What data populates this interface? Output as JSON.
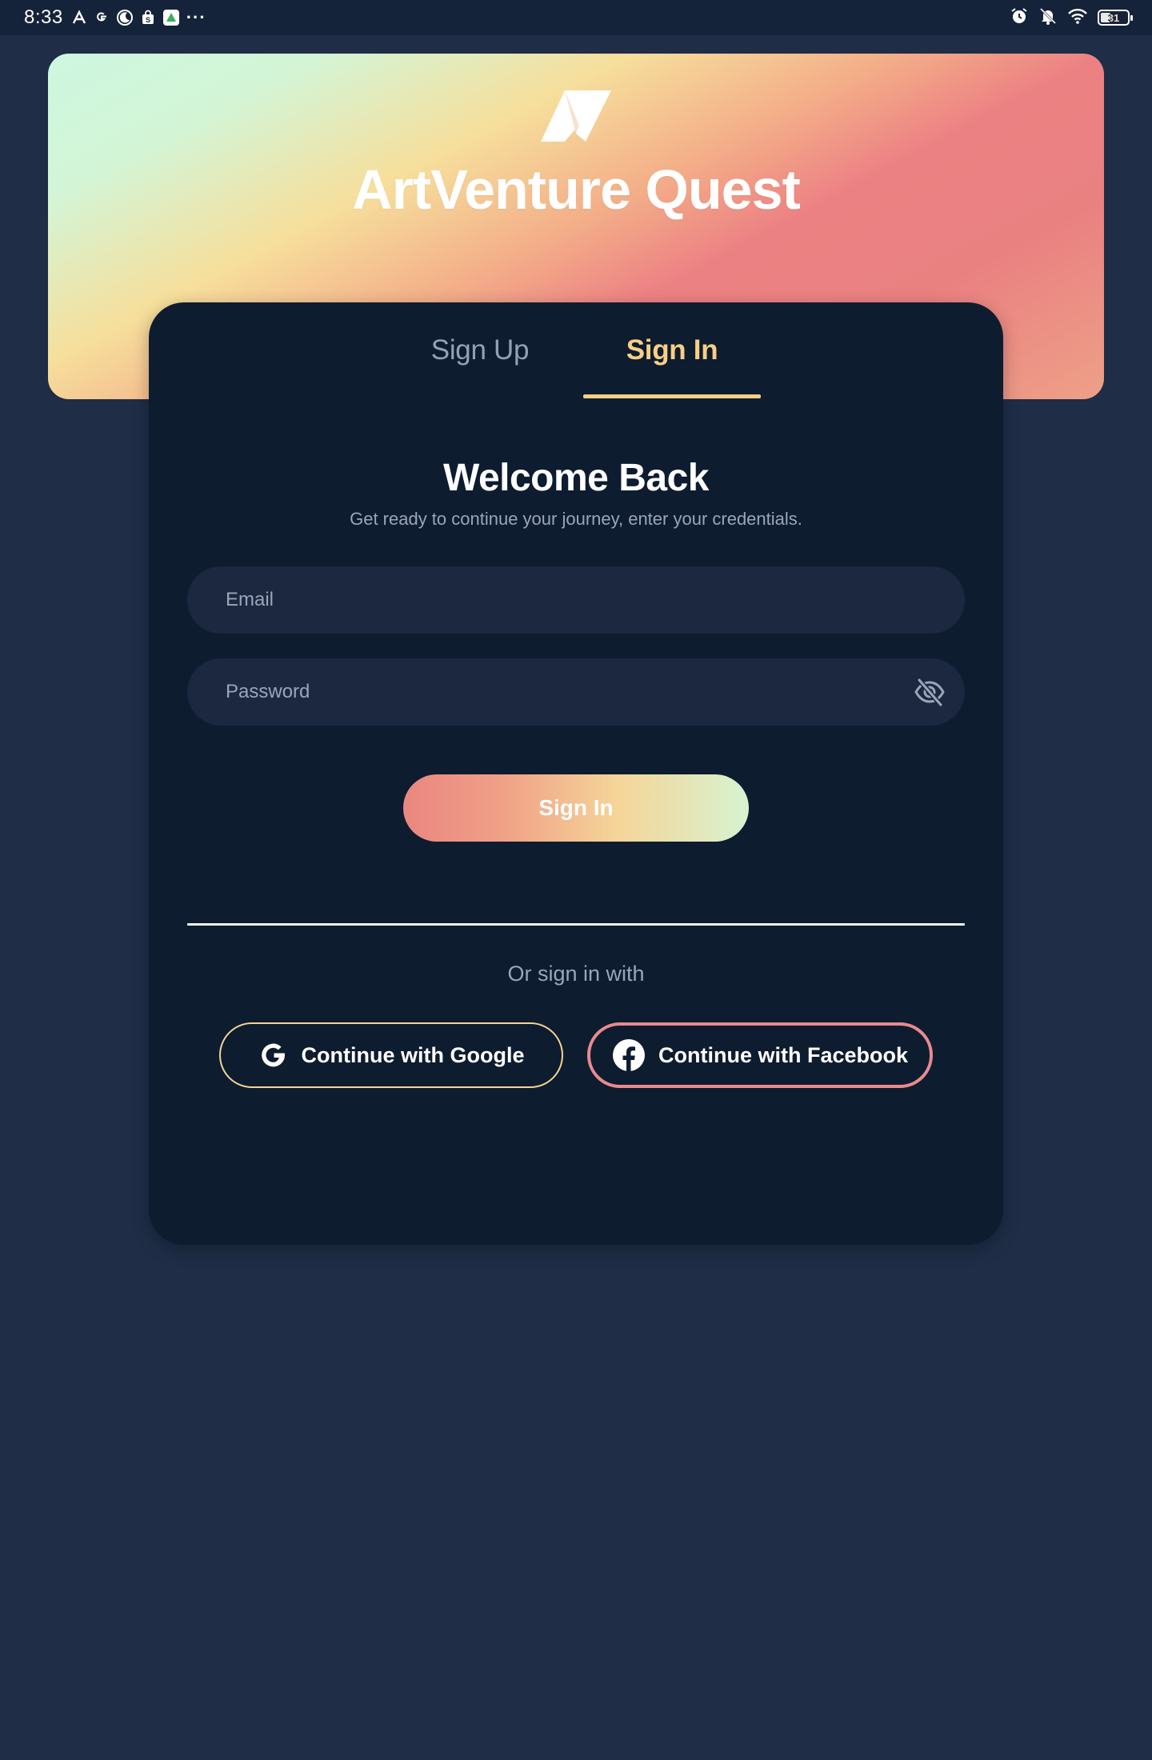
{
  "status_bar": {
    "time": "8:33",
    "more": "···",
    "battery_level": "31",
    "left_icons": [
      "app-a-icon",
      "google-icon",
      "moon-icon",
      "shopping-bag-icon",
      "green-app-icon"
    ],
    "right_icons": [
      "alarm-icon",
      "bell-off-icon",
      "wifi-icon",
      "battery-icon"
    ]
  },
  "hero": {
    "title": "ArtVenture Quest",
    "logo_icon": "map-fold-icon",
    "gradient_colors": [
      "#cdf7e0",
      "#f6df9c",
      "#ec8183"
    ]
  },
  "tabs": [
    {
      "label": "Sign Up",
      "active": false
    },
    {
      "label": "Sign In",
      "active": true
    }
  ],
  "form": {
    "heading": "Welcome Back",
    "subheading": "Get ready to continue your journey, enter your credentials.",
    "email_placeholder": "Email",
    "email_value": "",
    "password_placeholder": "Password",
    "password_value": "",
    "password_toggle_icon": "eye-off-icon",
    "submit_label": "Sign In"
  },
  "social": {
    "divider_text": "Or sign in with",
    "google_label": "Continue with Google",
    "facebook_label": "Continue with Facebook"
  },
  "colors": {
    "background": "#1f2d47",
    "card": "#0e1c30",
    "input": "#1b2840",
    "accent": "#f7cf86",
    "muted_text": "#94a0b6",
    "google_border": "#f2d594",
    "facebook_border": "#e98a8e"
  }
}
